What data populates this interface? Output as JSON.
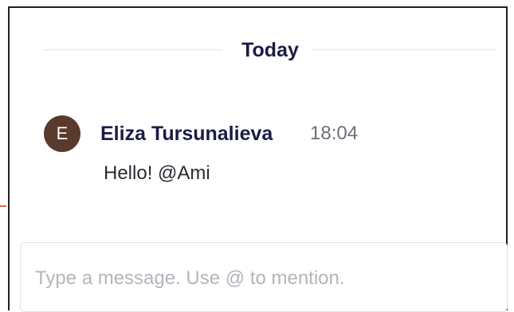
{
  "chat": {
    "date_divider": "Today",
    "messages": [
      {
        "avatar_initial": "E",
        "avatar_color": "#5b3a2e",
        "author": "Eliza Tursunalieva",
        "time": "18:04",
        "text": "Hello! @Ami"
      }
    ]
  },
  "composer": {
    "placeholder": "Type a message. Use @ to mention.",
    "value": ""
  },
  "colors": {
    "text_primary": "#1b1b45",
    "text_muted": "#6f6f7a",
    "placeholder": "#b4b4bc",
    "border": "#e2e2e6",
    "accent_marker": "#e06a3c"
  }
}
